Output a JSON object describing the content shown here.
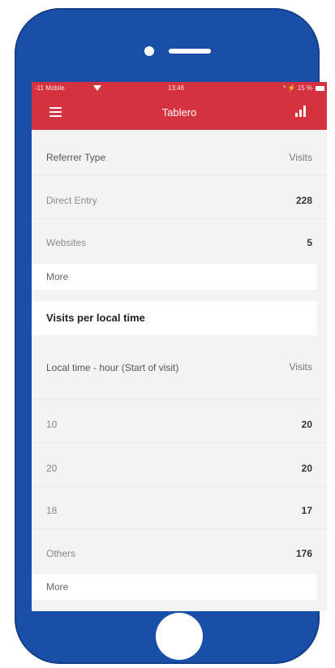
{
  "status_bar": {
    "carrier": "-11 Mobile",
    "time": "13:46",
    "battery": "* ⚡ 15 %"
  },
  "app_bar": {
    "title": "Tablero",
    "menu_icon": "hamburger-menu-icon",
    "chart_icon": "bar-chart-icon"
  },
  "referrers": {
    "header_label": "Referrer Type",
    "header_value": "Visits",
    "rows": [
      {
        "label": "Direct Entry",
        "value": "228"
      },
      {
        "label": "Websites",
        "value": "5"
      }
    ],
    "more_label": "More"
  },
  "local_time": {
    "title": "Visits per local time",
    "header_label": "Local time - hour (Start of visit)",
    "header_value": "Visits",
    "rows": [
      {
        "label": "10",
        "value": "20"
      },
      {
        "label": "20",
        "value": "20"
      },
      {
        "label": "18",
        "value": "17"
      },
      {
        "label": "Others",
        "value": "176"
      }
    ],
    "more_label": "More"
  },
  "colors": {
    "accent": "#d3323e",
    "phone_frame": "#1a4fa8"
  }
}
